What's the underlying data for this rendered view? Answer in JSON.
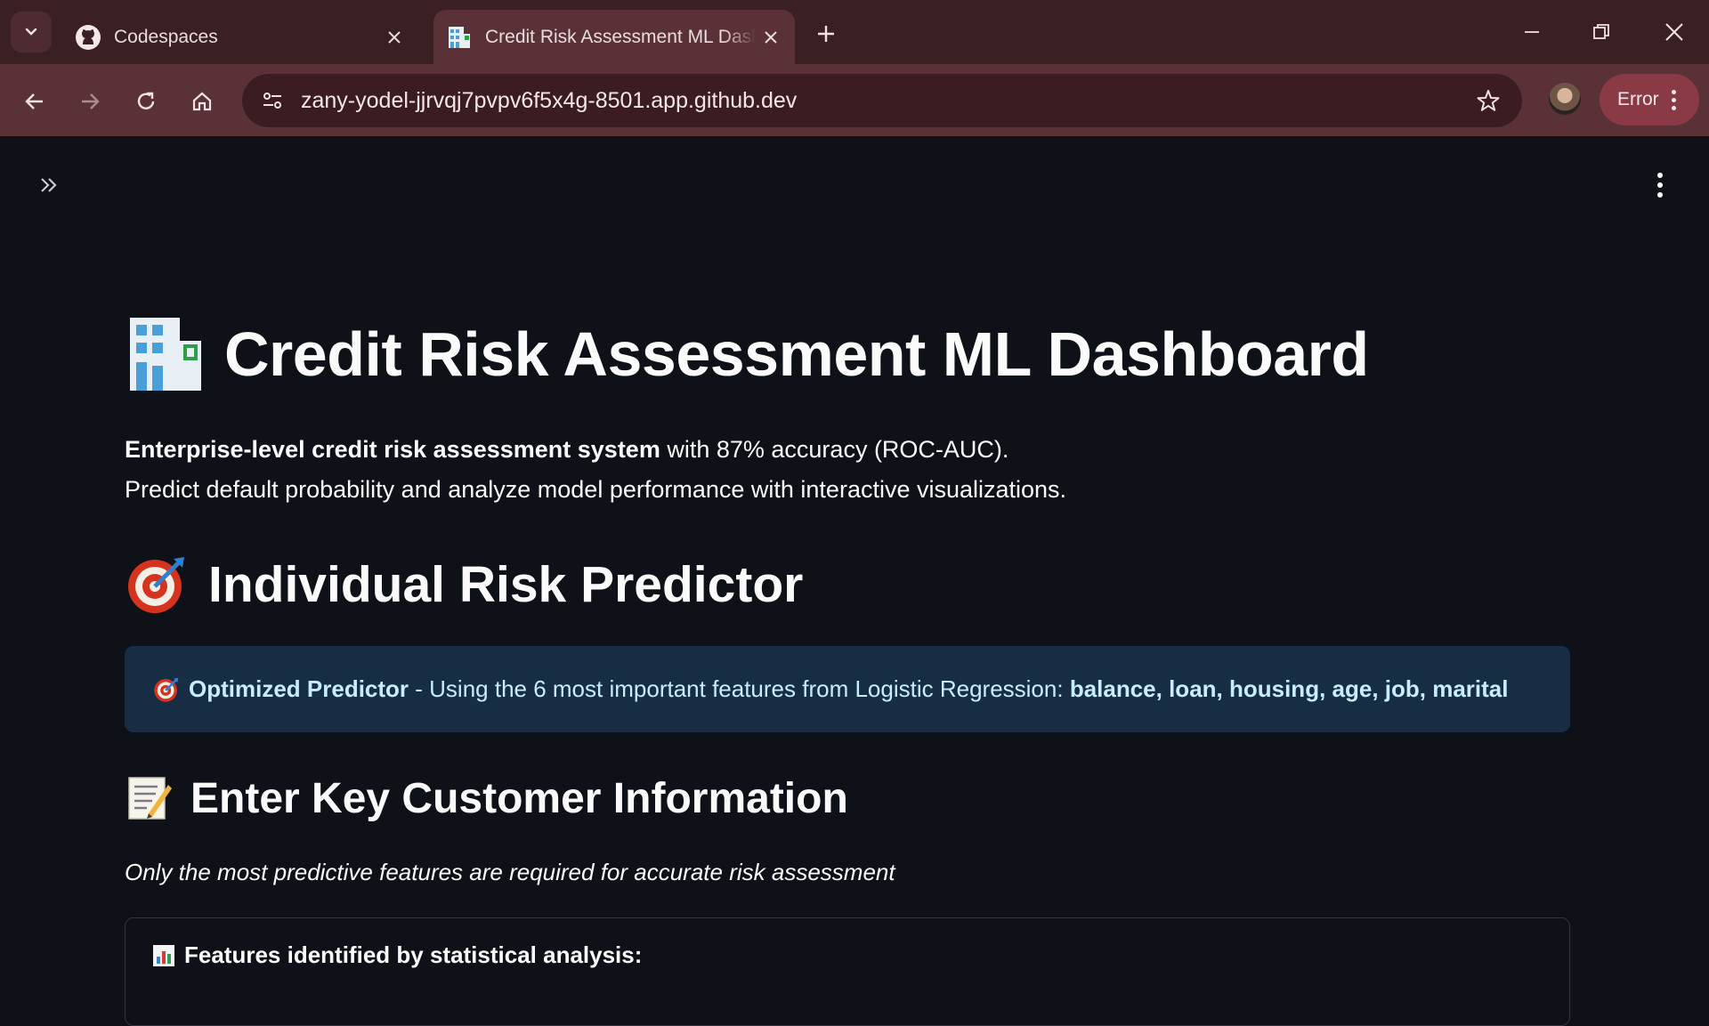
{
  "browser": {
    "tabs": [
      {
        "title": "Codespaces",
        "active": false,
        "icon": "github-icon"
      },
      {
        "title": "Credit Risk Assessment ML Dashboard",
        "active": true,
        "icon": "building-icon"
      }
    ],
    "url": "zany-yodel-jjrvqj7pvpv6f5x4g-8501.app.github.dev",
    "profile_status": "Error"
  },
  "app": {
    "title": "Credit Risk Assessment ML Dashboard",
    "intro": {
      "bold_part": "Enterprise-level credit risk assessment system",
      "rest_part": " with 87% accuracy (ROC-AUC).",
      "line2": "Predict default probability and analyze model performance with interactive visualizations."
    },
    "predictor": {
      "heading": "Individual Risk Predictor",
      "info_label": "Optimized Predictor",
      "info_text": " - Using the 6 most important features from Logistic Regression: ",
      "info_features": "balance, loan, housing, age, job, marital"
    },
    "customer_info": {
      "heading": "Enter Key Customer Information",
      "note": "Only the most predictive features are required for accurate risk assessment",
      "card_title": "Features identified by statistical analysis:"
    }
  },
  "colors": {
    "background": "#0e1117",
    "info_background": "#172d43",
    "info_text": "#c7ebff",
    "chrome_tabbar": "#3a1f23",
    "chrome_toolbar": "#5a3136",
    "error_pill": "#8a3a45"
  }
}
